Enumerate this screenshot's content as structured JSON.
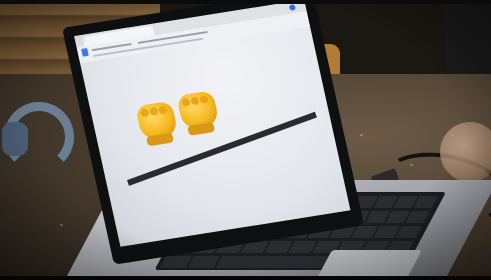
{
  "scene": {
    "description_tags": [
      "laptop",
      "wooden-table",
      "headphones",
      "cable"
    ]
  },
  "screen": {
    "emoji_count": 2,
    "emoji": [
      "fist-bump-emoji",
      "fist-bump-emoji"
    ]
  },
  "colors": {
    "emoji_yellow": "#f6b91e",
    "screen_bg": "#e4e7ec",
    "table": "#4d3f31",
    "laptop_silver": "#9ea1a6"
  }
}
